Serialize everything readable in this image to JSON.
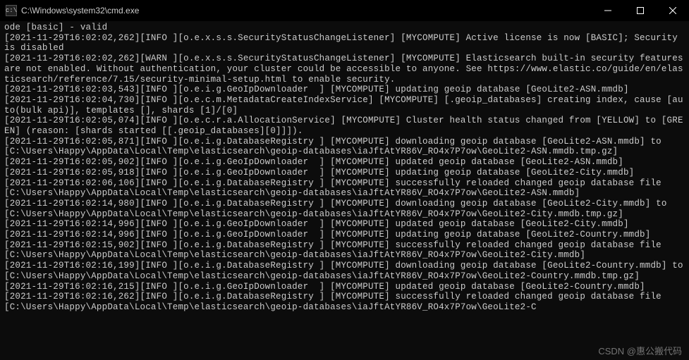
{
  "window": {
    "title": "C:\\Windows\\system32\\cmd.exe",
    "icon_name": "cmd-icon"
  },
  "terminal": {
    "lines": [
      "ode [basic] - valid",
      "[2021-11-29T16:02:02,262][INFO ][o.e.x.s.s.SecurityStatusChangeListener] [MYCOMPUTE] Active license is now [BASIC]; Security is disabled",
      "[2021-11-29T16:02:02,262][WARN ][o.e.x.s.s.SecurityStatusChangeListener] [MYCOMPUTE] Elasticsearch built-in security features are not enabled. Without authentication, your cluster could be accessible to anyone. See https://www.elastic.co/guide/en/elasticsearch/reference/7.15/security-minimal-setup.html to enable security.",
      "[2021-11-29T16:02:03,543][INFO ][o.e.i.g.GeoIpDownloader  ] [MYCOMPUTE] updating geoip database [GeoLite2-ASN.mmdb]",
      "[2021-11-29T16:02:04,730][INFO ][o.e.c.m.MetadataCreateIndexService] [MYCOMPUTE] [.geoip_databases] creating index, cause [auto(bulk api)], templates [], shards [1]/[0]",
      "[2021-11-29T16:02:05,074][INFO ][o.e.c.r.a.AllocationService] [MYCOMPUTE] Cluster health status changed from [YELLOW] to [GREEN] (reason: [shards started [[.geoip_databases][0]]]).",
      "[2021-11-29T16:02:05,871][INFO ][o.e.i.g.DatabaseRegistry ] [MYCOMPUTE] downloading geoip database [GeoLite2-ASN.mmdb] to [C:\\Users\\Happy\\AppData\\Local\\Temp\\elasticsearch\\geoip-databases\\iaJftAtYR86V_RO4x7P7ow\\GeoLite2-ASN.mmdb.tmp.gz]",
      "[2021-11-29T16:02:05,902][INFO ][o.e.i.g.GeoIpDownloader  ] [MYCOMPUTE] updated geoip database [GeoLite2-ASN.mmdb]",
      "[2021-11-29T16:02:05,918][INFO ][o.e.i.g.GeoIpDownloader  ] [MYCOMPUTE] updating geoip database [GeoLite2-City.mmdb]",
      "[2021-11-29T16:02:06,106][INFO ][o.e.i.g.DatabaseRegistry ] [MYCOMPUTE] successfully reloaded changed geoip database file [C:\\Users\\Happy\\AppData\\Local\\Temp\\elasticsearch\\geoip-databases\\iaJftAtYR86V_RO4x7P7ow\\GeoLite2-ASN.mmdb]",
      "[2021-11-29T16:02:14,980][INFO ][o.e.i.g.DatabaseRegistry ] [MYCOMPUTE] downloading geoip database [GeoLite2-City.mmdb] to [C:\\Users\\Happy\\AppData\\Local\\Temp\\elasticsearch\\geoip-databases\\iaJftAtYR86V_RO4x7P7ow\\GeoLite2-City.mmdb.tmp.gz]",
      "[2021-11-29T16:02:14,996][INFO ][o.e.i.g.GeoIpDownloader  ] [MYCOMPUTE] updated geoip database [GeoLite2-City.mmdb]",
      "[2021-11-29T16:02:14,996][INFO ][o.e.i.g.GeoIpDownloader  ] [MYCOMPUTE] updating geoip database [GeoLite2-Country.mmdb]",
      "[2021-11-29T16:02:15,902][INFO ][o.e.i.g.DatabaseRegistry ] [MYCOMPUTE] successfully reloaded changed geoip database file [C:\\Users\\Happy\\AppData\\Local\\Temp\\elasticsearch\\geoip-databases\\iaJftAtYR86V_RO4x7P7ow\\GeoLite2-City.mmdb]",
      "[2021-11-29T16:02:16,199][INFO ][o.e.i.g.DatabaseRegistry ] [MYCOMPUTE] downloading geoip database [GeoLite2-Country.mmdb] to [C:\\Users\\Happy\\AppData\\Local\\Temp\\elasticsearch\\geoip-databases\\iaJftAtYR86V_RO4x7P7ow\\GeoLite2-Country.mmdb.tmp.gz]",
      "[2021-11-29T16:02:16,215][INFO ][o.e.i.g.GeoIpDownloader  ] [MYCOMPUTE] updated geoip database [GeoLite2-Country.mmdb]",
      "[2021-11-29T16:02:16,262][INFO ][o.e.i.g.DatabaseRegistry ] [MYCOMPUTE] successfully reloaded changed geoip database file [C:\\Users\\Happy\\AppData\\Local\\Temp\\elasticsearch\\geoip-databases\\iaJftAtYR86V_RO4x7P7ow\\GeoLite2-C"
    ]
  },
  "watermark": "CSDN @惠公搬代码"
}
